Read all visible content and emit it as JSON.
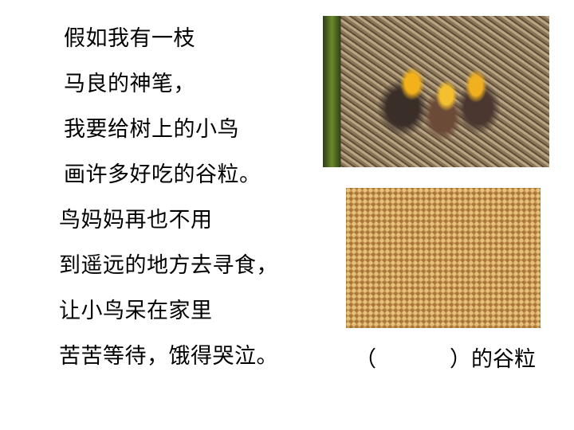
{
  "poem": {
    "lines": [
      "假如我有一枝",
      "马良的神笔，",
      "我要给树上的小鸟",
      "画许多好吃的谷粒。",
      "鸟妈妈再也不用",
      "到遥远的地方去寻食，",
      "让小鸟呆在家里",
      "苦苦等待，饿得哭泣。"
    ]
  },
  "images": {
    "top": "baby-birds-in-nest-photo",
    "bottom": "grain-photo"
  },
  "caption": {
    "open_paren": "（",
    "close_paren": "）",
    "text": "的谷粒"
  }
}
